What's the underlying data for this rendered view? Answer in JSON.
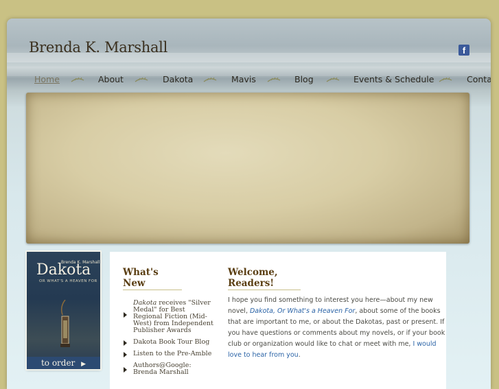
{
  "header": {
    "site_title": "Brenda K. Marshall",
    "facebook_icon": "facebook-icon"
  },
  "nav": {
    "items": [
      {
        "label": "Home",
        "active": true
      },
      {
        "label": "About"
      },
      {
        "label": "Dakota"
      },
      {
        "label": "Mavis"
      },
      {
        "label": "Blog"
      },
      {
        "label": "Events & Schedule"
      },
      {
        "label": "Contact"
      }
    ],
    "separator_icon": "wheat-ornament-icon"
  },
  "book": {
    "author": "Brenda K. Marshall",
    "title": "Dakota",
    "subtitle": "OR WHAT'S A HEAVEN FOR",
    "order_label": "to order"
  },
  "news": {
    "title": "What's New",
    "items": [
      {
        "italic": "Dakota",
        "text": " receives \"Silver Medal\" for Best Regional Fiction (Mid-West) from Independent Publisher Awards"
      },
      {
        "text": "Dakota Book Tour Blog"
      },
      {
        "text": "Listen to the Pre-Amble"
      },
      {
        "text": "Authors@Google: Brenda Marshall"
      }
    ]
  },
  "welcome": {
    "title": "Welcome, Readers!",
    "p1": "I hope you find something to interest you here—about my new novel, ",
    "book_link": "Dakota, Or What's a Heaven For",
    "p2": ", about some of the books that are important to me, or about the Dakotas, past or present. If you have questions or comments about my novels, or if your book club or organization would like to chat or meet with me, ",
    "contact_link": "I would love to hear from you",
    "p3": "."
  },
  "colors": {
    "outer_bg": "#c9c184",
    "heading": "#5a3e12",
    "link": "#2a63a6",
    "book_cover": "#2b4259"
  }
}
